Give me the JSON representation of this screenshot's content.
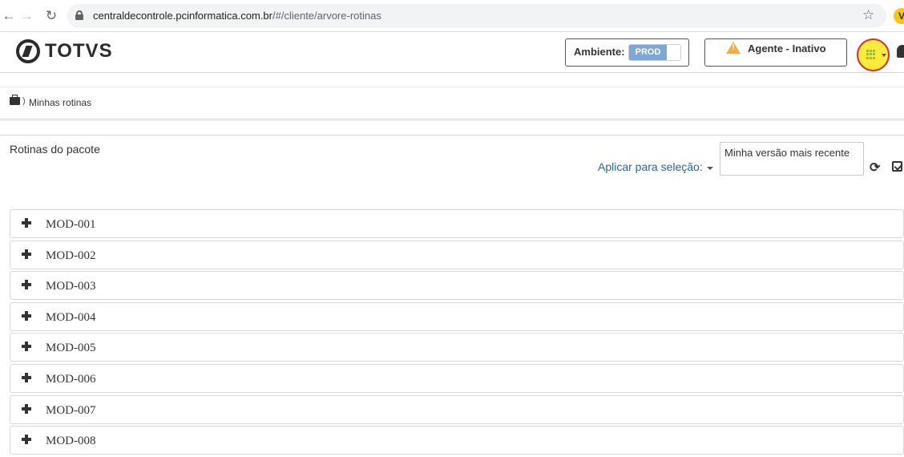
{
  "browser": {
    "url_host": "centraldecontrole.pcinformatica.com.br",
    "url_path": "/#/cliente/arvore-rotinas",
    "extension_letter": "V"
  },
  "header": {
    "brand": "TOTVS",
    "ambiente_label": "Ambiente:",
    "ambiente_value": "PROD",
    "agent_label": "Agente - Inativo",
    "agent_warning_mark": "!"
  },
  "breadcrumb": {
    "separator": ")",
    "current": "Minhas rotinas"
  },
  "content": {
    "section_title": "Rotinas do pacote",
    "apply_label": "Aplicar para seleção:",
    "version_value": "Minha versão mais recente",
    "refresh_glyph": "⟳"
  },
  "modules": [
    {
      "label": "MOD-001"
    },
    {
      "label": "MOD-002"
    },
    {
      "label": "MOD-003"
    },
    {
      "label": "MOD-004"
    },
    {
      "label": "MOD-005"
    },
    {
      "label": "MOD-006"
    },
    {
      "label": "MOD-007"
    },
    {
      "label": "MOD-008"
    }
  ],
  "colors": {
    "link": "#2a6496",
    "toggle_on": "#7fa7d6",
    "warning": "#f0ad4e",
    "highlight_fill": "#ffeb3b",
    "highlight_ring": "#d32f2f"
  },
  "icons": {
    "back": "back-arrow-icon",
    "forward": "forward-arrow-icon",
    "reload": "reload-icon",
    "lock": "lock-icon",
    "bookmark": "star-icon",
    "apps": "apps-grid-icon",
    "notifications": "bell-icon",
    "breadcrumb": "briefcase-icon",
    "expand": "plus-icon"
  }
}
